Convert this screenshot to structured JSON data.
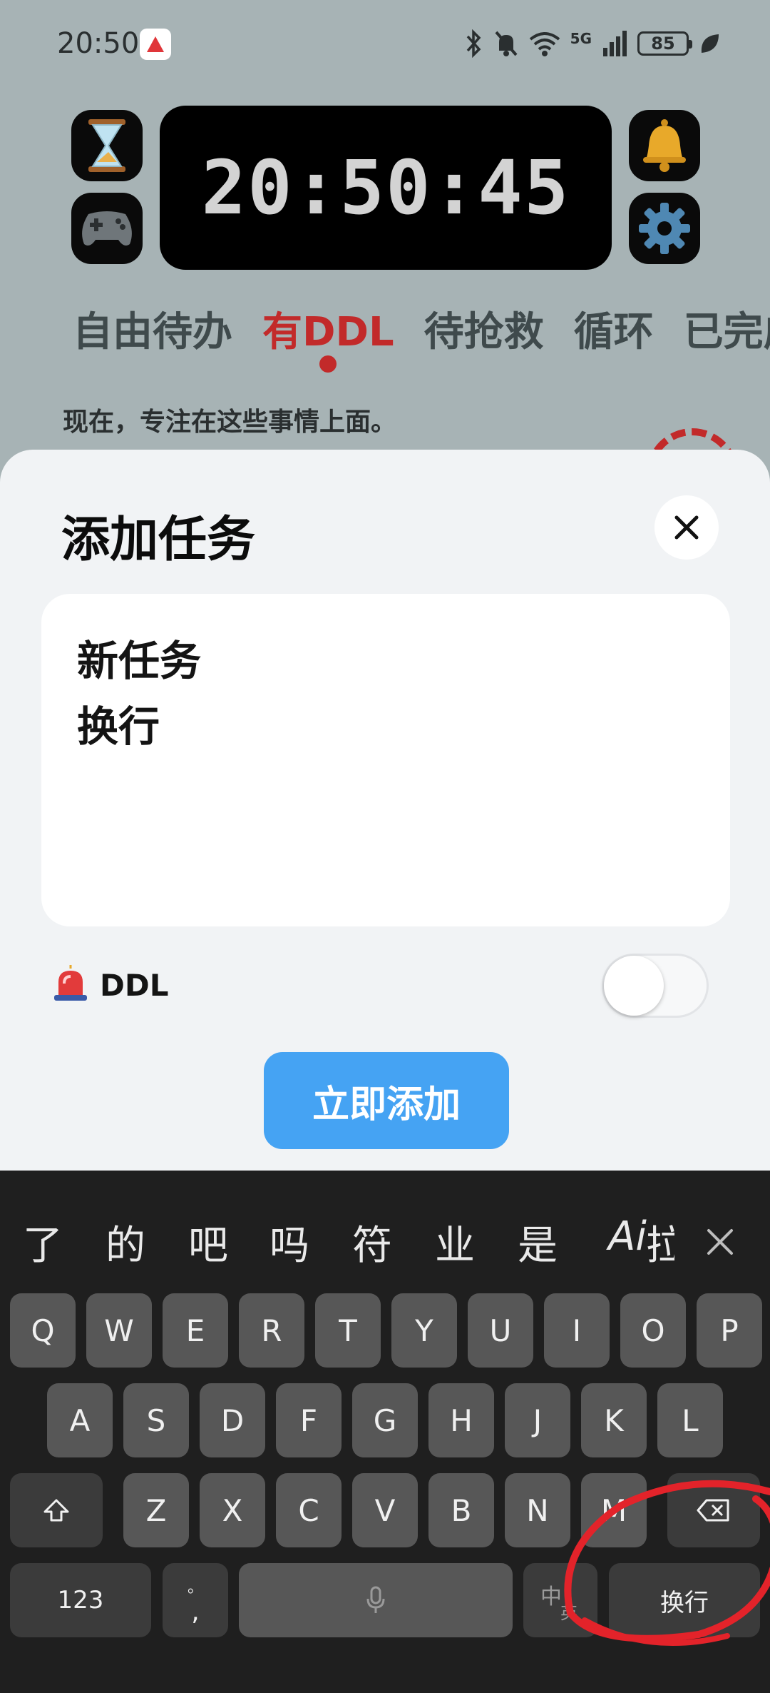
{
  "status_bar": {
    "time": "20:50",
    "battery": "85",
    "network": "5G"
  },
  "clock": {
    "time": "20:50:45"
  },
  "tabs": [
    {
      "label": "自由待办",
      "active": false
    },
    {
      "label": "有DDL",
      "active": true
    },
    {
      "label": "待抢救",
      "active": false
    },
    {
      "label": "循环",
      "active": false
    },
    {
      "label": "已完成",
      "active": false
    }
  ],
  "subtitle": "现在，专注在这些事情上面。",
  "sheet": {
    "title": "添加任务",
    "task_lines": [
      "新任务",
      "换行"
    ],
    "ddl_label": "DDL",
    "ddl_enabled": false,
    "add_button": "立即添加"
  },
  "keyboard": {
    "suggestions": [
      "了",
      "的",
      "吧",
      "吗",
      "符",
      "业",
      "是",
      "Ai",
      "拉"
    ],
    "row1": [
      "Q",
      "W",
      "E",
      "R",
      "T",
      "Y",
      "U",
      "I",
      "O",
      "P"
    ],
    "row2": [
      "A",
      "S",
      "D",
      "F",
      "G",
      "H",
      "J",
      "K",
      "L"
    ],
    "row3": [
      "Z",
      "X",
      "C",
      "V",
      "B",
      "N",
      "M"
    ],
    "num_key": "123",
    "punct_key_top": "。",
    "punct_key_bottom": ",",
    "lang_key_top": "中",
    "lang_key_bottom": "英",
    "enter_key": "换行"
  },
  "colors": {
    "accent_blue": "#45a3f3",
    "accent_red": "#c22a2a",
    "background": "#a7b3b5",
    "keyboard": "#1f1f1f"
  }
}
